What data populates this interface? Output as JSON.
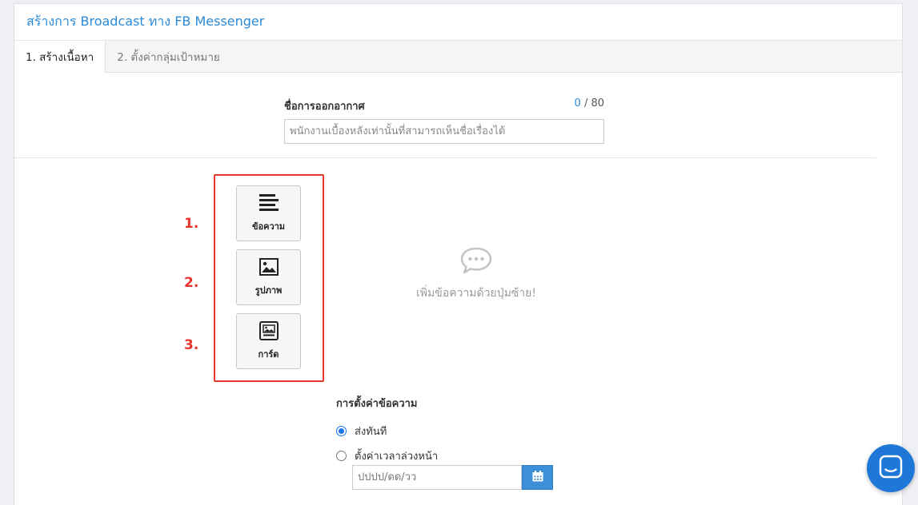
{
  "header": {
    "title": "สร้างการ Broadcast ทาง FB Messenger"
  },
  "tabs": [
    {
      "label": "1. สร้างเนื้อหา",
      "active": true
    },
    {
      "label": "2. ตั้งค่ากลุ่มเป้าหมาย",
      "active": false
    }
  ],
  "broadcast_name": {
    "label": "ชื่อการออกอากาศ",
    "count_current": "0",
    "count_max": "/ 80",
    "placeholder": "พนักงานเบื้องหลังเท่านั้นที่สามารถเห็นชื่อเรื่องได้",
    "value": ""
  },
  "content_tools": [
    {
      "number": "1.",
      "label": "ข้อความ",
      "icon": "text-lines-icon"
    },
    {
      "number": "2.",
      "label": "รูปภาพ",
      "icon": "image-icon"
    },
    {
      "number": "3.",
      "label": "การ์ด",
      "icon": "card-icon"
    }
  ],
  "empty_state": {
    "icon": "speech-bubble-icon",
    "text": "เพิ่มข้อความด้วยปุ่มซ้าย!"
  },
  "message_settings": {
    "title": "การตั้งค่าข้อความ",
    "options": [
      {
        "label": "ส่งทันที",
        "checked": true
      },
      {
        "label": "ตั้งค่าเวลาล่วงหน้า",
        "checked": false
      }
    ],
    "date_placeholder": "ปปปป/ดด/วว"
  },
  "colors": {
    "accent": "#2a8ad8",
    "highlight": "#e8352a",
    "launcher": "#1f78d8"
  }
}
